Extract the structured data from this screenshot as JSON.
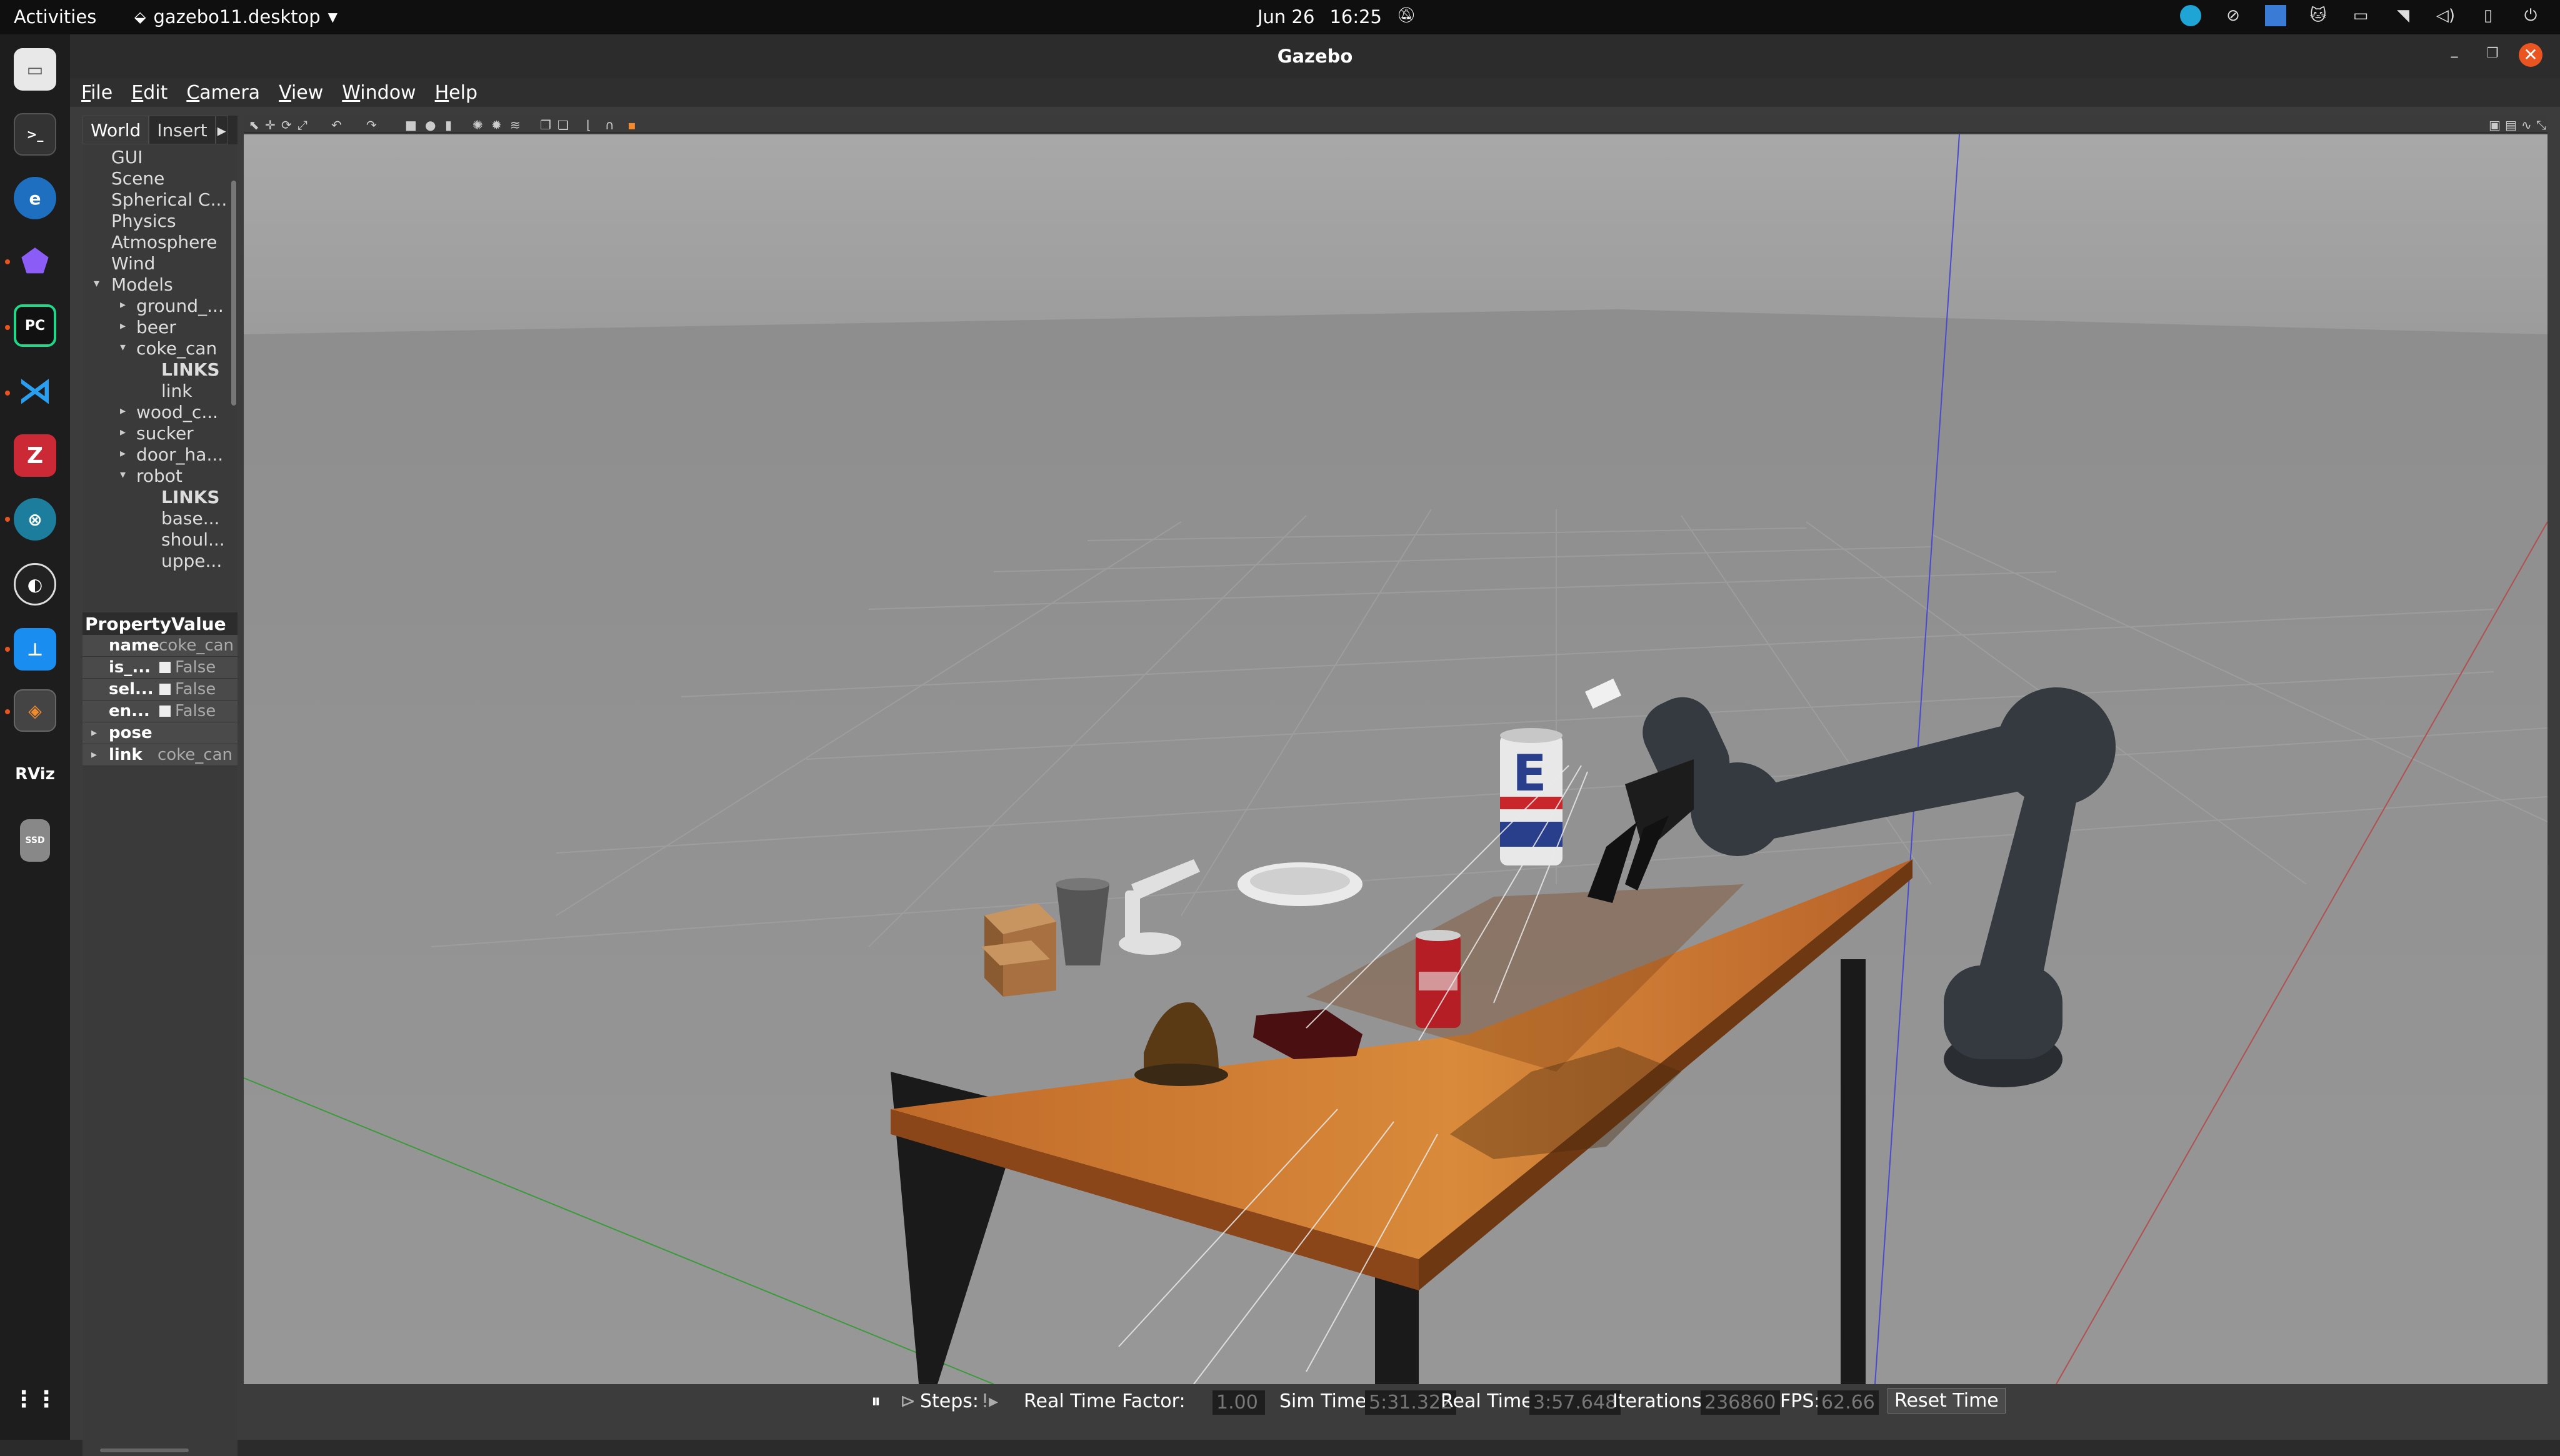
{
  "topbar": {
    "activities": "Activities",
    "app": "gazebo11.desktop",
    "date": "Jun 26",
    "time": "16:25"
  },
  "window": {
    "title": "Gazebo"
  },
  "menu": {
    "file": "File",
    "edit": "Edit",
    "camera": "Camera",
    "view": "View",
    "window": "Window",
    "help": "Help"
  },
  "tabs": {
    "world": "World",
    "insert": "Insert"
  },
  "tree": {
    "gui": "GUI",
    "scene": "Scene",
    "spherical": "Spherical C...",
    "physics": "Physics",
    "atmosphere": "Atmosphere",
    "wind": "Wind",
    "models": "Models",
    "ground": "ground_...",
    "beer": "beer",
    "coke_can": "coke_can",
    "links1": "LINKS",
    "link": "link",
    "wood": "wood_c...",
    "sucker": "sucker",
    "door": "door_ha...",
    "robot": "robot",
    "links2": "LINKS",
    "base": "base...",
    "shoulder": "shoul...",
    "upper": "uppe..."
  },
  "props": {
    "h_property": "Property",
    "h_value": "Value",
    "name_k": "name",
    "name_v": "coke_can",
    "is_k": "is_...",
    "is_v": "False",
    "sel_k": "sel...",
    "sel_v": "False",
    "en_k": "en...",
    "en_v": "False",
    "pose_k": "pose",
    "link_k": "link",
    "link_v": "coke_can"
  },
  "status": {
    "steps": "Steps:",
    "rtf_label": "Real Time Factor:",
    "rtf": "1.00",
    "sim_label": "Sim Time:",
    "sim": "5:31.322",
    "real_label": "Real Time:",
    "real": "3:57.648",
    "iter_label": "Iterations:",
    "iter": "236860",
    "fps_label": "FPS:",
    "fps": "62.66",
    "reset": "Reset Time"
  },
  "can_label": "E"
}
